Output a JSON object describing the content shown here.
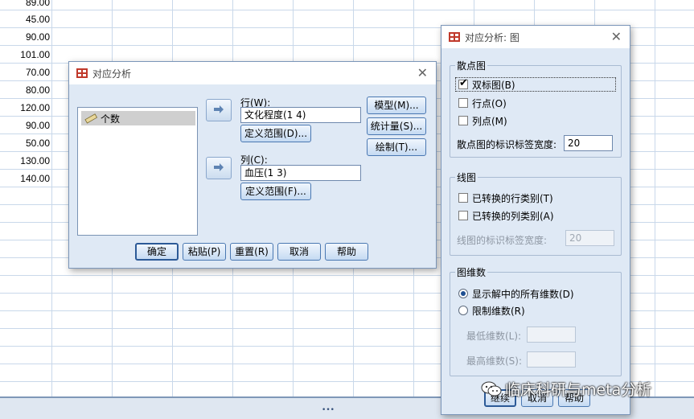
{
  "sheet": {
    "column_values": [
      "89.00",
      "45.00",
      "90.00",
      "101.00",
      "70.00",
      "80.00",
      "120.00",
      "90.00",
      "50.00",
      "130.00",
      "140.00"
    ]
  },
  "dialog_main": {
    "title": "对应分析",
    "variables": [
      {
        "label": "个数",
        "icon": "ruler-icon"
      }
    ],
    "row_label": "行(W):",
    "row_value": "文化程度(1 4)",
    "row_define_range": "定义范围(D)...",
    "col_label": "列(C):",
    "col_value": "血压(1 3)",
    "col_define_range": "定义范围(F)...",
    "side_buttons": {
      "model": "模型(M)...",
      "statistics": "统计量(S)...",
      "plots": "绘制(T)..."
    },
    "footer_buttons": {
      "ok": "确定",
      "paste": "粘贴(P)",
      "reset": "重置(R)",
      "cancel": "取消",
      "help": "帮助"
    }
  },
  "dialog_plots": {
    "title": "对应分析: 图",
    "scatter_group": {
      "title": "散点图",
      "biplot": {
        "label": "双标图(B)",
        "checked": true
      },
      "row_points": {
        "label": "行点(O)",
        "checked": false
      },
      "col_points": {
        "label": "列点(M)",
        "checked": false
      },
      "label_width_label": "散点图的标识标签宽度:",
      "label_width_value": "20"
    },
    "line_group": {
      "title": "线图",
      "transformed_row": {
        "label": "已转换的行类别(T)",
        "checked": false
      },
      "transformed_col": {
        "label": "已转换的列类别(A)",
        "checked": false
      },
      "label_width_label": "线图的标识标签宽度:",
      "label_width_value": "20"
    },
    "dims_group": {
      "title": "图维数",
      "show_all": {
        "label": "显示解中的所有维数(D)",
        "selected": true
      },
      "restrict": {
        "label": "限制维数(R)",
        "selected": false
      },
      "min_label": "最低维数(L):",
      "max_label": "最高维数(S):"
    },
    "footer_buttons": {
      "continue": "继续",
      "cancel": "取消",
      "help": "帮助"
    }
  },
  "watermark": {
    "text": "临床科研与meta分析",
    "icon": "wechat-icon"
  },
  "colors": {
    "dialog_bg": "#dfe9f5",
    "button_border": "#4a78b2",
    "grid_line": "#c9d8ea"
  }
}
